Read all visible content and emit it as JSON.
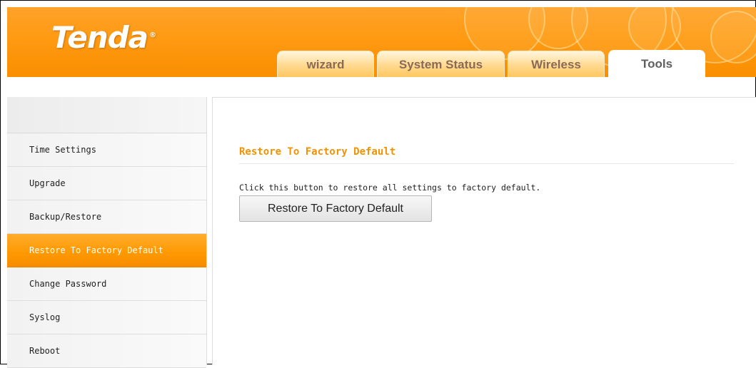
{
  "brand": {
    "logo": "Tenda",
    "mark": "®"
  },
  "colors": {
    "accent": "#f39200",
    "header_orange": "#ff9a12",
    "tab_gold": "#ffd98e"
  },
  "tabs": [
    {
      "label": "wizard"
    },
    {
      "label": "System Status"
    },
    {
      "label": "Wireless"
    },
    {
      "label": "Tools",
      "active": true
    }
  ],
  "sidebar": {
    "items": [
      {
        "label": "Time Settings"
      },
      {
        "label": "Upgrade"
      },
      {
        "label": "Backup/Restore"
      },
      {
        "label": "Restore To Factory Default",
        "active": true
      },
      {
        "label": "Change Password"
      },
      {
        "label": "Syslog"
      },
      {
        "label": "Reboot"
      }
    ]
  },
  "main": {
    "title": "Restore To Factory Default",
    "description": "Click this button to restore all settings to factory default.",
    "button_label": "Restore To Factory Default"
  }
}
